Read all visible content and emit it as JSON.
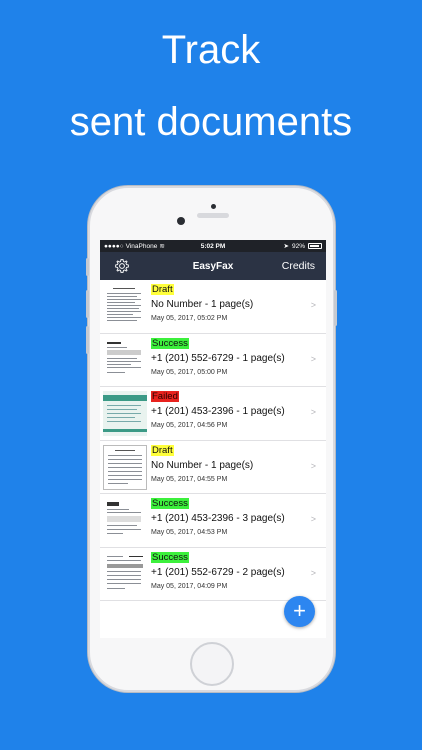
{
  "headline": {
    "line1": "Track",
    "line2": "sent documents"
  },
  "statusbar": {
    "carrier": "VinaPhone",
    "time": "5:02 PM",
    "battery": "92%"
  },
  "navbar": {
    "title": "EasyFax",
    "credits_label": "Credits",
    "settings_icon": "gear-icon"
  },
  "colors": {
    "background": "#1f82ea",
    "navbar": "#2b3344",
    "draft": "#ffff3b",
    "success": "#3cf03c",
    "failed": "#e8221e",
    "fab": "#2d86f0"
  },
  "faxes": [
    {
      "status": "Draft",
      "number": "No Number - 1 page(s)",
      "date": "May 05, 2017, 05:02 PM"
    },
    {
      "status": "Success",
      "number": "+1 (201) 552-6729 - 1 page(s)",
      "date": "May 05, 2017, 05:00 PM"
    },
    {
      "status": "Failed",
      "number": "+1 (201) 453-2396 - 1 page(s)",
      "date": "May 05, 2017, 04:56 PM"
    },
    {
      "status": "Draft",
      "number": "No Number - 1 page(s)",
      "date": "May 05, 2017, 04:55 PM"
    },
    {
      "status": "Success",
      "number": "+1 (201) 453-2396 - 3 page(s)",
      "date": "May 05, 2017, 04:53 PM"
    },
    {
      "status": "Success",
      "number": "+1 (201) 552-6729 - 2 page(s)",
      "date": "May 05, 2017, 04:09 PM"
    }
  ],
  "fab": {
    "label": "+"
  }
}
